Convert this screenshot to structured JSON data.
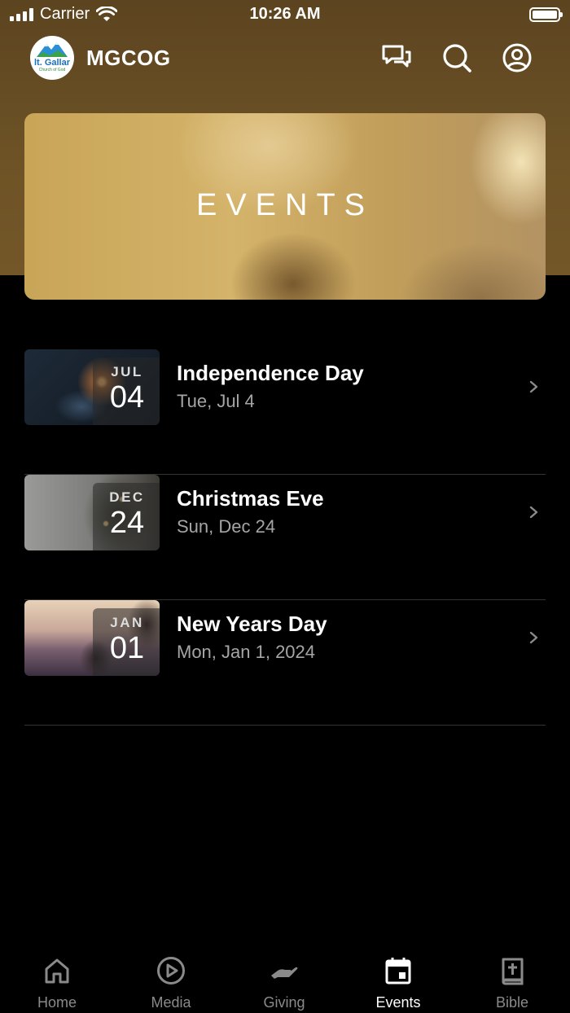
{
  "status_bar": {
    "carrier": "Carrier",
    "time": "10:26 AM"
  },
  "header": {
    "logo_text": "lt. Gallar",
    "logo_subtext": "Church of God",
    "title": "MGCOG",
    "icons": [
      "chat-icon",
      "search-icon",
      "account-icon"
    ]
  },
  "banner": {
    "title": "EVENTS"
  },
  "events": [
    {
      "month": "JUL",
      "day": "04",
      "title": "Independence Day",
      "date": "Tue, Jul 4"
    },
    {
      "month": "DEC",
      "day": "24",
      "title": "Christmas Eve",
      "date": "Sun, Dec 24"
    },
    {
      "month": "JAN",
      "day": "01",
      "title": "New Years Day",
      "date": "Mon, Jan 1, 2024"
    }
  ],
  "tabbar": {
    "active": "Events",
    "tabs": [
      {
        "label": "Home",
        "icon": "home-icon"
      },
      {
        "label": "Media",
        "icon": "play-icon"
      },
      {
        "label": "Giving",
        "icon": "giving-hand-icon"
      },
      {
        "label": "Events",
        "icon": "calendar-icon"
      },
      {
        "label": "Bible",
        "icon": "bible-icon"
      }
    ]
  },
  "colors": {
    "header_brown": "#6e5326",
    "background": "#000000",
    "tab_inactive": "#8a8a8a",
    "subtitle_gray": "#a5a5a5"
  }
}
